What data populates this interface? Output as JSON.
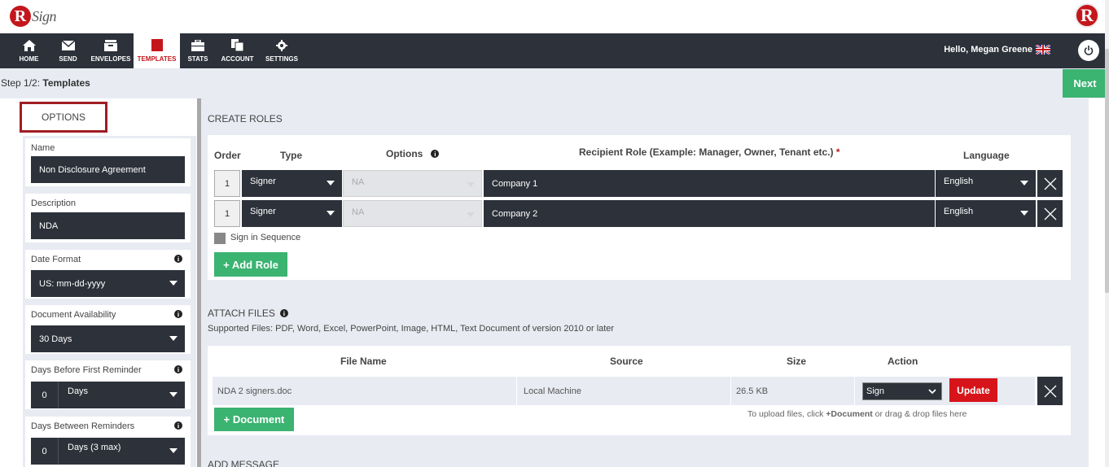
{
  "app": {
    "logo_letter": "R",
    "logo_text": "Sign",
    "brand_letter": "R"
  },
  "nav": {
    "items": [
      {
        "label": "HOME",
        "icon": "home-icon"
      },
      {
        "label": "SEND",
        "icon": "envelope-icon"
      },
      {
        "label": "ENVELOPES",
        "icon": "inbox-icon"
      },
      {
        "label": "TEMPLATES",
        "icon": "document-icon",
        "active": true
      },
      {
        "label": "STATS",
        "icon": "briefcase-icon"
      },
      {
        "label": "ACCOUNT",
        "icon": "copy-icon"
      },
      {
        "label": "SETTINGS",
        "icon": "gear-icon"
      }
    ],
    "greeting": "Hello, Megan Greene"
  },
  "step": {
    "prefix": "Step 1/2: ",
    "title": "Templates",
    "next_label": "Next"
  },
  "options": {
    "header": "OPTIONS",
    "name_label": "Name",
    "name_value": "Non Disclosure Agreement",
    "description_label": "Description",
    "description_value": "NDA",
    "date_format_label": "Date Format",
    "date_format_value": "US: mm-dd-yyyy",
    "availability_label": "Document Availability",
    "availability_value": "30 Days",
    "first_reminder_label": "Days Before First Reminder",
    "first_reminder_num": "0",
    "first_reminder_unit": "Days",
    "between_label": "Days Between Reminders",
    "between_num": "0",
    "between_unit": "Days (3 max)"
  },
  "roles": {
    "title": "CREATE ROLES",
    "headers": {
      "order": "Order",
      "type": "Type",
      "options": "Options",
      "recipient": "Recipient Role (Example: Manager, Owner, Tenant etc.)",
      "required": "*",
      "language": "Language"
    },
    "rows": [
      {
        "order": "1",
        "type": "Signer",
        "option": "NA",
        "role": "Company 1",
        "language": "English"
      },
      {
        "order": "1",
        "type": "Signer",
        "option": "NA",
        "role": "Company 2",
        "language": "English"
      }
    ],
    "sequence_label": "Sign in Sequence",
    "add_role_label": "+ Add Role"
  },
  "files": {
    "title": "ATTACH FILES",
    "supported": "Supported Files: PDF, Word, Excel, PowerPoint, Image, HTML, Text Document of version 2010 or later",
    "headers": {
      "name": "File Name",
      "source": "Source",
      "size": "Size",
      "action": "Action"
    },
    "rows": [
      {
        "name": "NDA 2 signers.doc",
        "source": "Local Machine",
        "size": "26.5 KB",
        "action": "Sign",
        "update_label": "Update"
      }
    ],
    "add_document_label": "+ Document",
    "upload_hint_pre": "To upload files, click ",
    "upload_hint_bold": "+Document",
    "upload_hint_post": " or drag & drop files here"
  },
  "message": {
    "title": "ADD MESSAGE"
  }
}
